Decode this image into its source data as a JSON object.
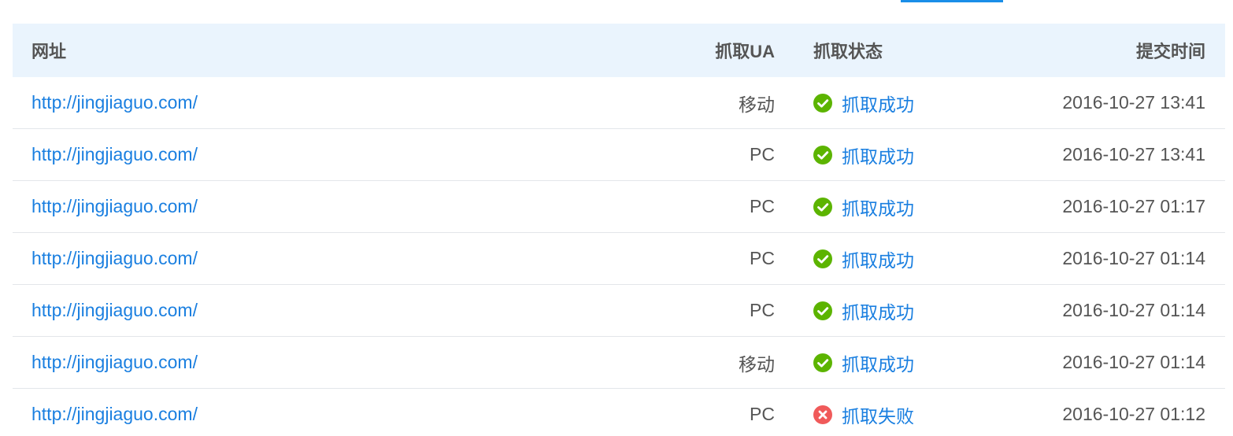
{
  "header": {
    "url": "网址",
    "ua": "抓取UA",
    "status": "抓取状态",
    "time": "提交时间"
  },
  "colors": {
    "link": "#1a7fe0",
    "success": "#5cb400",
    "fail": "#f05a5a",
    "header_bg": "#eaf4fd",
    "tab_accent": "#1a8ee8"
  },
  "rows": [
    {
      "url": "http://jingjiaguo.com/",
      "ua": "移动",
      "status": "抓取成功",
      "status_type": "success",
      "time": "2016-10-27 13:41"
    },
    {
      "url": "http://jingjiaguo.com/",
      "ua": "PC",
      "status": "抓取成功",
      "status_type": "success",
      "time": "2016-10-27 13:41"
    },
    {
      "url": "http://jingjiaguo.com/",
      "ua": "PC",
      "status": "抓取成功",
      "status_type": "success",
      "time": "2016-10-27 01:17"
    },
    {
      "url": "http://jingjiaguo.com/",
      "ua": "PC",
      "status": "抓取成功",
      "status_type": "success",
      "time": "2016-10-27 01:14"
    },
    {
      "url": "http://jingjiaguo.com/",
      "ua": "PC",
      "status": "抓取成功",
      "status_type": "success",
      "time": "2016-10-27 01:14"
    },
    {
      "url": "http://jingjiaguo.com/",
      "ua": "移动",
      "status": "抓取成功",
      "status_type": "success",
      "time": "2016-10-27 01:14"
    },
    {
      "url": "http://jingjiaguo.com/",
      "ua": "PC",
      "status": "抓取失败",
      "status_type": "fail",
      "time": "2016-10-27 01:12"
    }
  ]
}
